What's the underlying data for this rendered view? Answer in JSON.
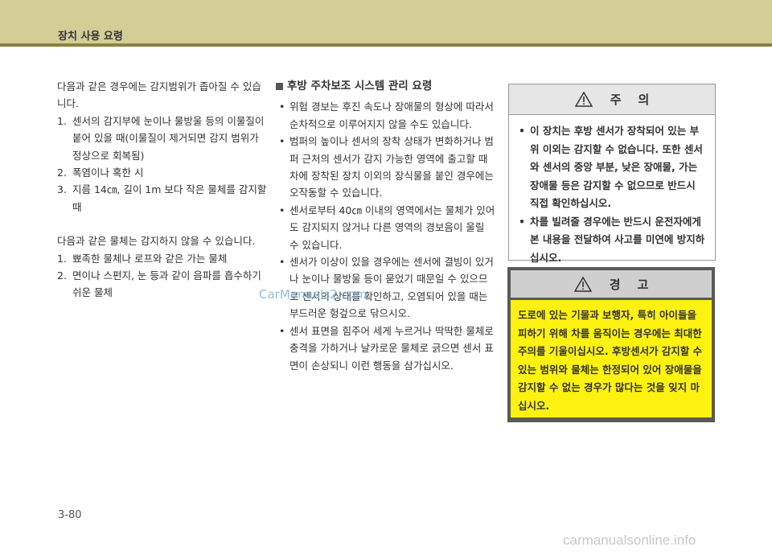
{
  "header": {
    "title": "장치 사용 요령"
  },
  "column1": {
    "intro1": "다음과 같은 경우에는 감지범위가 좁아질 수 있습니다.",
    "list1": [
      {
        "num": "1.",
        "text": "센서의 감지부에 눈이나 물방울 등의 이물질이 붙어 있을 때(이물질이 제거되면 감지 범위가 정상으로 회복됨)"
      },
      {
        "num": "2.",
        "text": "폭염이나 혹한 시"
      },
      {
        "num": "3.",
        "text": "지름 14㎝, 길이 1m 보다 작은 물체를 감지할 때"
      }
    ],
    "intro2": "다음과 같은 물체는 감지하지 않을 수 있습니다.",
    "list2": [
      {
        "num": "1.",
        "text": "뾰족한 물체나 로프와 같은 가는 물체"
      },
      {
        "num": "2.",
        "text": "면이나 스펀지, 눈 등과 같이 음파를 흡수하기 쉬운 물체"
      }
    ]
  },
  "column2": {
    "title": "후방 주차보조 시스템 관리 요령",
    "bullets": [
      "위험 경보는 후진 속도나 장애물의 형상에 따라서 순차적으로 이루어지지 않을 수도 있습니다.",
      "범퍼의 높이나 센서의 장착 상태가 변화하거나 범퍼 근처의 센서가 감지 가능한 영역에 출고할 때 차에 장착된 장치 이외의 장식물을 붙인 경우에는 오작동할 수 있습니다.",
      "센서로부터 40㎝ 이내의 영역에서는 물체가 있어도 감지되지 않거나 다른 영역의 경보음이 울릴 수 있습니다.",
      "센서가 이상이 있을 경우에는 센서에 결빙이 있거나 눈이나 물방울 등이 묻었기 때문일 수 있으므로 센서의 상태를 확인하고, 오염되어 있을 때는 부드러운 헝겊으로 닦으시오.",
      "센서 표면을 힘주어 세게 누르거나 딱딱한 물체로 충격을 가하거나 날카로운 물체로 긁으면 센서 표면이 손상되니 이런 행동을 삼가십시오."
    ]
  },
  "caution": {
    "title": "주    의",
    "items": [
      "이 장치는 후방 센서가 장착되어 있는 부위 이외는 감지할 수 없습니다. 또한 센서와 센서의 중앙 부분, 낮은 장애물, 가는 장애물 등은 감지할 수 없으므로 반드시 직접 확인하십시오.",
      "차를 빌려줄 경우에는 반드시 운전자에게 본 내용을 전달하여 사고를 미연에 방지하십시오."
    ]
  },
  "warning": {
    "title": "경    고",
    "text": "도로에 있는 기물과 보행자, 특히 아이들을 피하기 위해 차를 움직이는 경우에는 최대한 주의를 기울이십시오. 후방센서가 감지할 수 있는 범위와 물체는 한정되어 있어 장애물을 감지할 수 없는 경우가 많다는 것을 잊지 마십시오."
  },
  "watermark": "CarManuals2.com",
  "footer_watermark": "carmanualsonline.info",
  "page_number": "3-80",
  "colors": {
    "header_bg": "#d3cd96",
    "header_bar": "#8a8240",
    "warning_yellow": "#fff212",
    "warning_frame": "#5a5a5a"
  }
}
